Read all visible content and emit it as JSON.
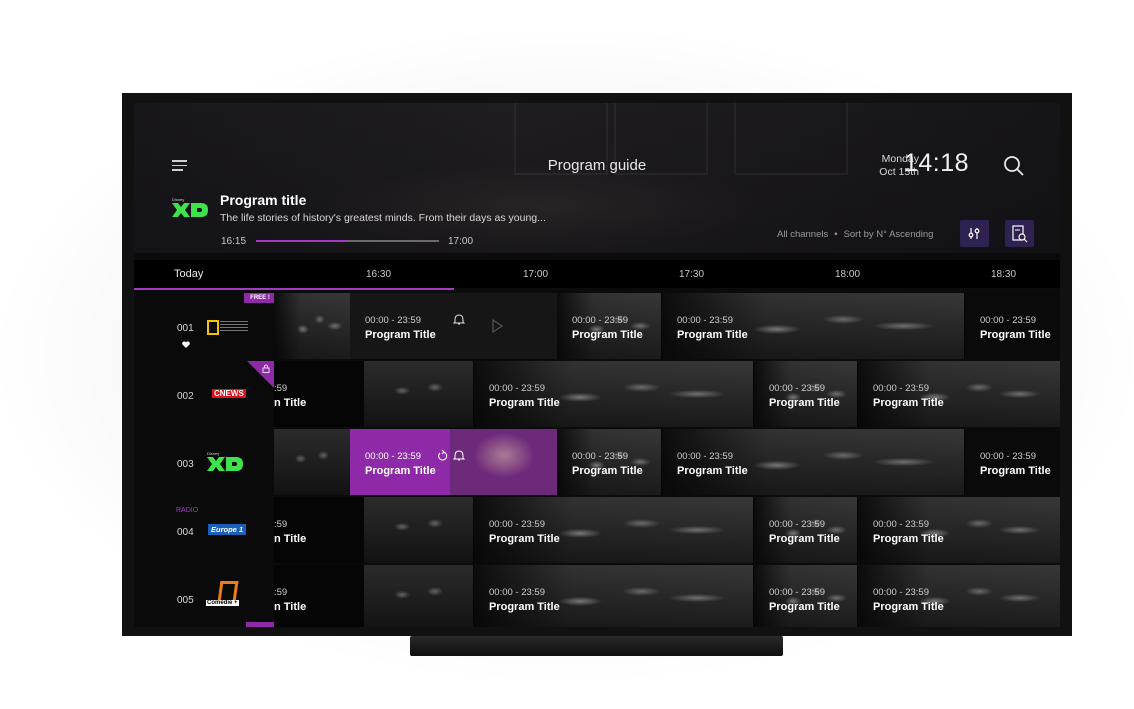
{
  "header": {
    "page_title": "Program guide",
    "date_line1": "Monday",
    "date_line2": "Oct 15th",
    "time": "14:18"
  },
  "hero": {
    "channel_logo": "XD",
    "title": "Program title",
    "description": "The life stories of history's greatest minds. From their days as young...",
    "start": "16:15",
    "end": "17:00",
    "progress": 0.5
  },
  "filters": {
    "channels": "All channels",
    "sort": "Sort by N° Ascending"
  },
  "timeline": {
    "today": "Today",
    "slots": [
      "16:30",
      "17:00",
      "17:30",
      "18:00",
      "18:30"
    ]
  },
  "rows": [
    {
      "number": "001",
      "badge": "FREE !",
      "programs": [
        {
          "time": "00:00 - 23:59",
          "title": "Program Title"
        },
        {
          "time": "00:00 - 23:59",
          "title": "Program Title"
        },
        {
          "time": "00:00 - 23:59",
          "title": "Program Title"
        },
        {
          "time": "00:00 - 23:59",
          "title": "Program Title"
        }
      ]
    },
    {
      "number": "002",
      "logo": "CNEWS",
      "programs": [
        {
          "time": ":59",
          "title": "n Title"
        },
        {
          "time": "00:00 - 23:59",
          "title": "Program Title"
        },
        {
          "time": "00:00 - 23:59",
          "title": "Program Title"
        },
        {
          "time": "00:00 - 23:59",
          "title": "Program Title"
        }
      ]
    },
    {
      "number": "003",
      "logo": "XD",
      "programs": [
        {
          "time": "00:00 - 23:59",
          "title": "Program Title"
        },
        {
          "time": "00:00 - 23:59",
          "title": "Program Title"
        },
        {
          "time": "00:00 - 23:59",
          "title": "Program Title"
        },
        {
          "time": "00:00 - 23:59",
          "title": "Program Title"
        }
      ]
    },
    {
      "number": "004",
      "tag": "RADIO",
      "logo": "Europe 1",
      "programs": [
        {
          "time": ":59",
          "title": "n Title"
        },
        {
          "time": "00:00 - 23:59",
          "title": "Program Title"
        },
        {
          "time": "00:00 - 23:59",
          "title": "Program Title"
        },
        {
          "time": "00:00 - 23:59",
          "title": "Program Title"
        }
      ]
    },
    {
      "number": "005",
      "logo": "Comedie +",
      "programs": [
        {
          "time": ":59",
          "title": "n Title"
        },
        {
          "time": "00:00 - 23:59",
          "title": "Program Title"
        },
        {
          "time": "00:00 - 23:59",
          "title": "Program Title"
        },
        {
          "time": "00:00 - 23:59",
          "title": "Program Title"
        }
      ]
    }
  ],
  "colors": {
    "accent": "#a43ac4",
    "selected": "#8e2aa8",
    "xd_green": "#3ee24a"
  }
}
